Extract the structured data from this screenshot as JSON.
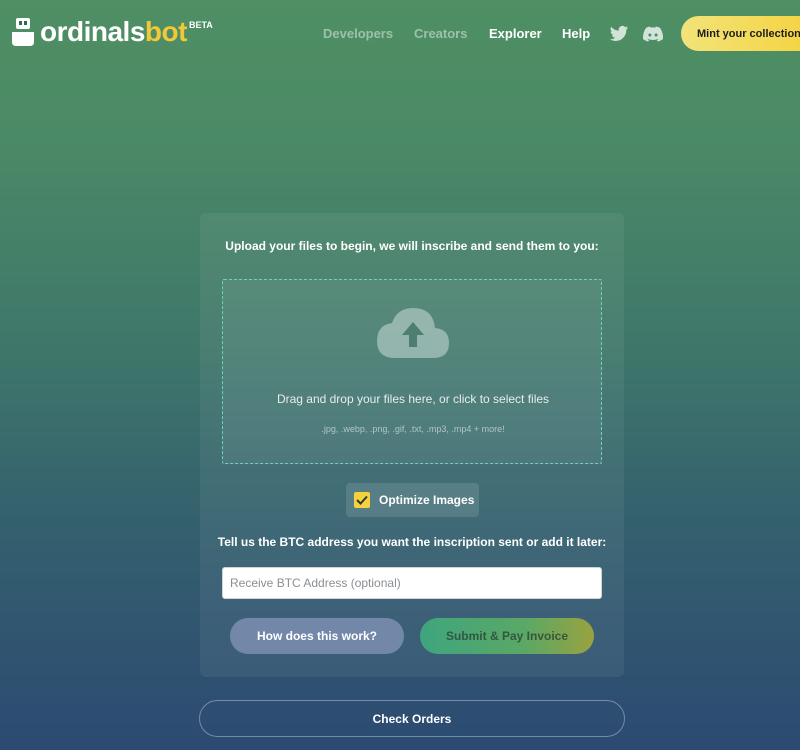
{
  "brand": {
    "name_part1": "ordinals",
    "name_part2": "bot",
    "badge": "BETA",
    "icon": "robot-logo-icon",
    "colors": {
      "white": "#ffffff",
      "accent": "#f3c73a"
    }
  },
  "nav": {
    "links": [
      {
        "label": "Developers",
        "state": "dim"
      },
      {
        "label": "Creators",
        "state": "dim"
      },
      {
        "label": "Explorer",
        "state": "active"
      },
      {
        "label": "Help",
        "state": "active"
      }
    ],
    "icons": [
      "twitter-icon",
      "discord-icon"
    ],
    "cta_label": "Mint your collection"
  },
  "upload": {
    "title": "Upload your files to begin, we will inscribe and send them to you:",
    "drop_text": "Drag and drop your files here, or click to select files",
    "file_types": ".jpg, .webp, .png, .gif, .txt, .mp3, .mp4 + more!",
    "icon": "cloud-upload-icon"
  },
  "optimize": {
    "label": "Optimize Images",
    "checked": true
  },
  "btc": {
    "title": "Tell us the BTC address you want the inscription sent or add it later:",
    "placeholder": "Receive BTC Address (optional)",
    "value": ""
  },
  "actions": {
    "how_label": "How does this work?",
    "submit_label": "Submit & Pay Invoice",
    "check_orders_label": "Check Orders"
  }
}
